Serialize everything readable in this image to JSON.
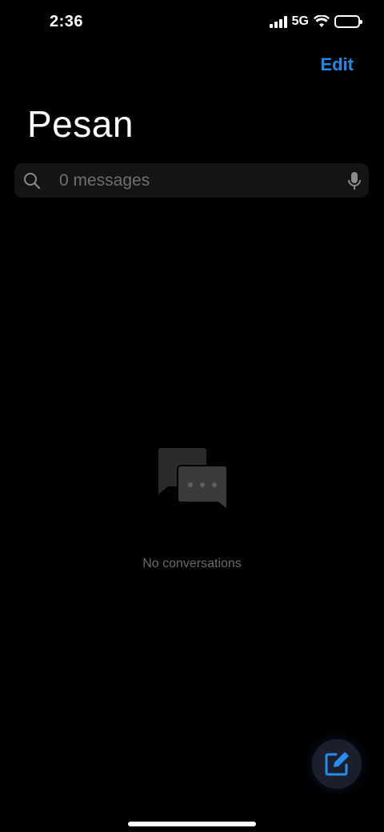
{
  "status_bar": {
    "time": "2:36",
    "network": "5G"
  },
  "header": {
    "edit_label": "Edit",
    "title": "Pesan"
  },
  "search": {
    "placeholder": "0 messages"
  },
  "empty_state": {
    "icon": "chat-bubbles-icon",
    "text": "No conversations"
  },
  "fab": {
    "icon": "compose-icon"
  },
  "colors": {
    "accent": "#1e88e5",
    "background": "#000000",
    "search_bg": "#141414",
    "muted_text": "#6a6a6a"
  }
}
